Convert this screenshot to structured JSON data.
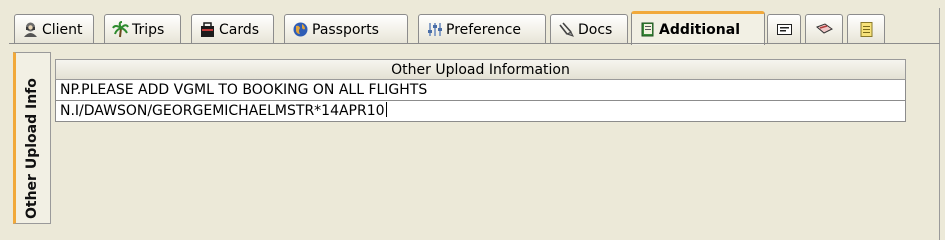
{
  "tabs": [
    {
      "label": "Client",
      "icon": "client-icon"
    },
    {
      "label": "Trips",
      "icon": "palm-tree-icon"
    },
    {
      "label": "Cards",
      "icon": "card-case-icon"
    },
    {
      "label": "Passports",
      "icon": "globe-icon"
    },
    {
      "label": "Preference",
      "icon": "preference-icon"
    },
    {
      "label": "Docs",
      "icon": "docs-icon"
    },
    {
      "label": "Additional",
      "icon": "book-icon"
    },
    {
      "label": "",
      "icon": "card-reader-icon"
    },
    {
      "label": "",
      "icon": "ticket-icon"
    },
    {
      "label": "",
      "icon": "notepad-icon"
    }
  ],
  "active_tab": "Additional",
  "side_tab": {
    "label": "Other Upload Info"
  },
  "table": {
    "header": "Other Upload Information",
    "rows": [
      "NP.PLEASE ADD VGML TO BOOKING ON ALL FLIGHTS",
      "N.I/DAWSON/GEORGEMICHAELMSTR*14APR10"
    ]
  },
  "colors": {
    "active_accent": "#f1a93b",
    "panel_bg": "#ece9d8"
  }
}
